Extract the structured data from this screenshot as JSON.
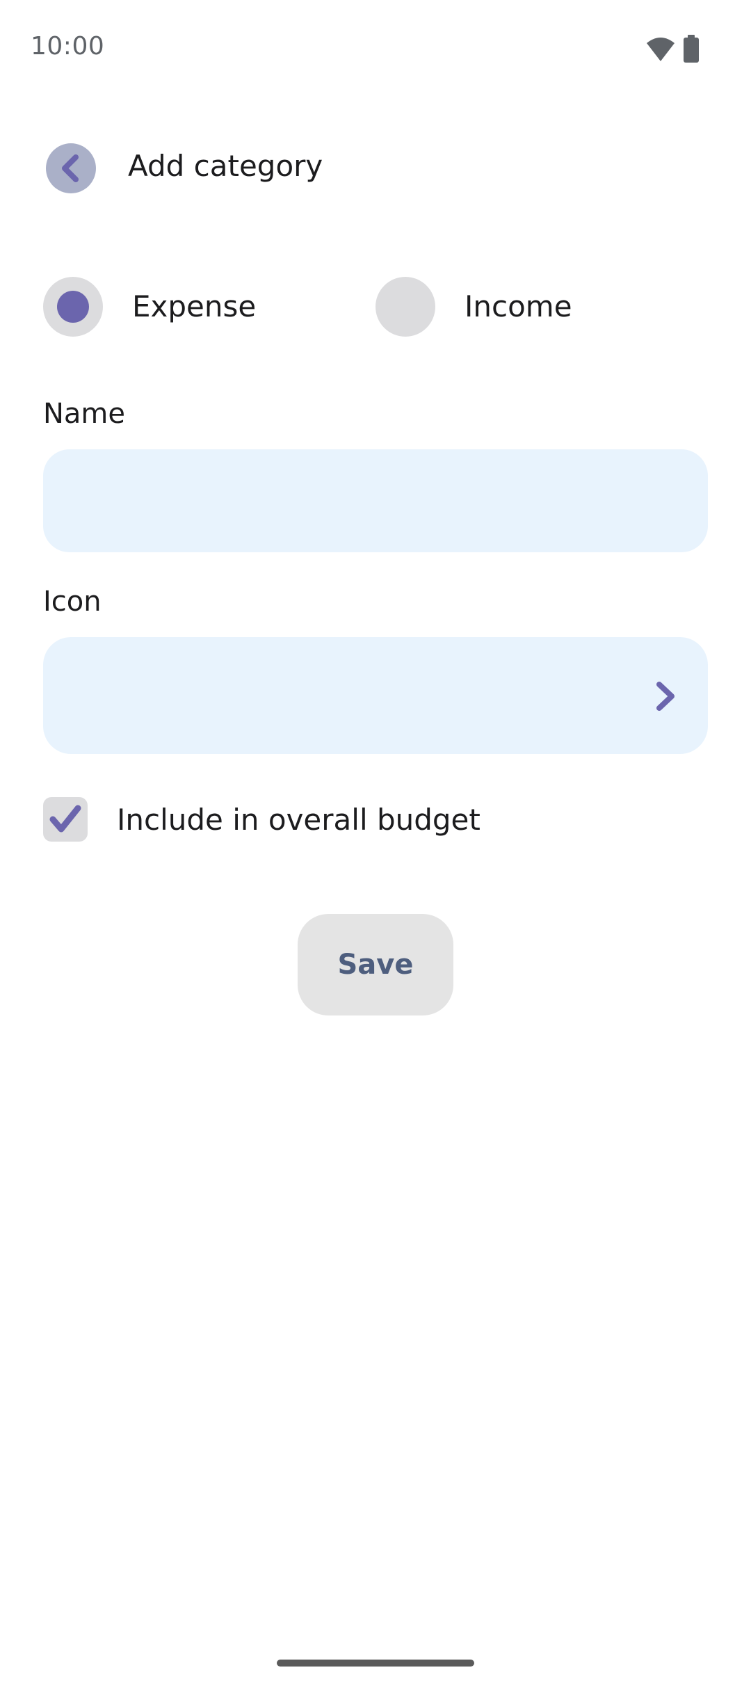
{
  "status_bar": {
    "time": "10:00",
    "icons": [
      "wifi-icon",
      "battery-icon"
    ]
  },
  "header": {
    "back_icon": "chevron-left-icon",
    "title": "Add category"
  },
  "type_selector": {
    "options": [
      {
        "label": "Expense",
        "selected": true
      },
      {
        "label": "Income",
        "selected": false
      }
    ]
  },
  "name_field": {
    "label": "Name",
    "value": "",
    "placeholder": ""
  },
  "icon_field": {
    "label": "Icon",
    "value": "",
    "action_icon": "chevron-right-icon"
  },
  "budget_option": {
    "label": "Include in overall budget",
    "checked": true
  },
  "actions": {
    "save_label": "Save"
  },
  "colors": {
    "accent": "#6b65ad",
    "back_button_bg": "#aab0c8",
    "field_bg": "#e8f3fd",
    "control_bg": "#dcdcde",
    "save_button_bg": "#e4e4e4",
    "save_text": "#4e5e7e"
  }
}
